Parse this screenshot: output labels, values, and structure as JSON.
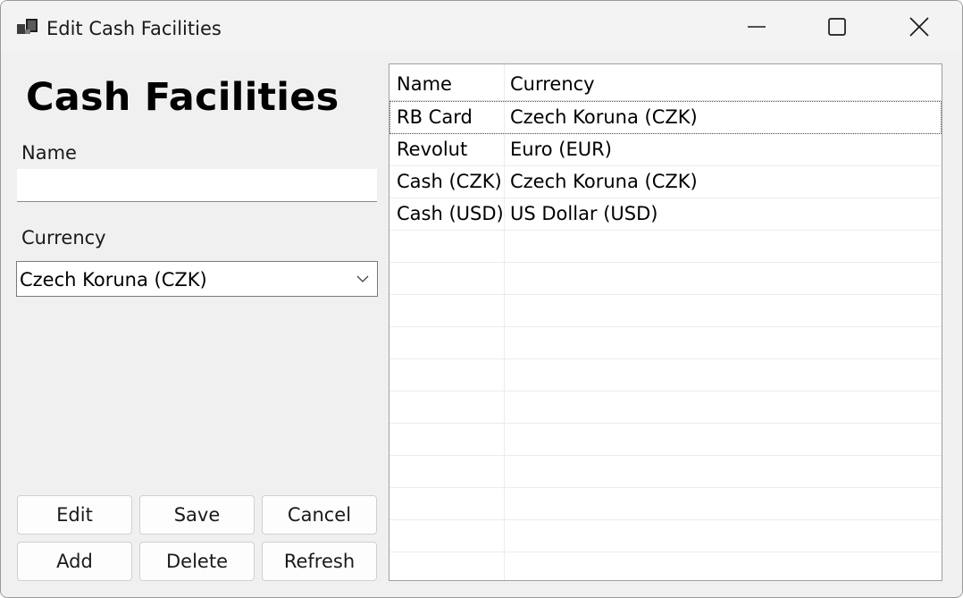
{
  "window": {
    "title": "Edit Cash Facilities",
    "icons": {
      "app": "app-icon",
      "minimize": "minimize-icon",
      "maximize": "maximize-icon",
      "close": "close-icon"
    }
  },
  "form": {
    "heading": "Cash Facilities",
    "name_label": "Name",
    "name_value": "",
    "currency_label": "Currency",
    "currency_value": "Czech Koruna (CZK)"
  },
  "buttons": {
    "edit": "Edit",
    "save": "Save",
    "cancel": "Cancel",
    "add": "Add",
    "delete": "Delete",
    "refresh": "Refresh"
  },
  "grid": {
    "columns": [
      "Name",
      "Currency"
    ],
    "rows": [
      {
        "name": "RB Card",
        "currency": "Czech Koruna (CZK)"
      },
      {
        "name": "Revolut",
        "currency": "Euro (EUR)"
      },
      {
        "name": "Cash (CZK)",
        "currency": "Czech Koruna (CZK)"
      },
      {
        "name": "Cash (USD)",
        "currency": "US Dollar (USD)"
      }
    ],
    "selected_row": 0
  }
}
